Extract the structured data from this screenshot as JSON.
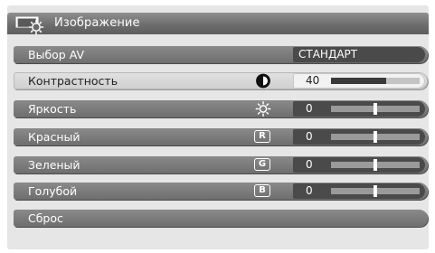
{
  "title": "Изображение",
  "menu": {
    "av_select": {
      "label": "Выбор AV",
      "value": "СТАНДАРТ"
    },
    "contrast": {
      "label": "Контрастность",
      "value": "40",
      "level": 0.62
    },
    "brightness": {
      "label": "Яркость",
      "value": "0",
      "level": 0.5,
      "icon": "sun-icon"
    },
    "red": {
      "label": "Красный",
      "value": "0",
      "level": 0.5,
      "letter": "R"
    },
    "green": {
      "label": "Зеленый",
      "value": "0",
      "level": 0.5,
      "letter": "G"
    },
    "blue": {
      "label": "Голубой",
      "value": "0",
      "level": 0.5,
      "letter": "B"
    },
    "reset": {
      "label": "Сброс"
    }
  },
  "colors": {
    "row": "#7c7c7c",
    "selected_row": "#d8d8d8",
    "track": "#9a9a9a",
    "fill": "#3a3a3a"
  }
}
